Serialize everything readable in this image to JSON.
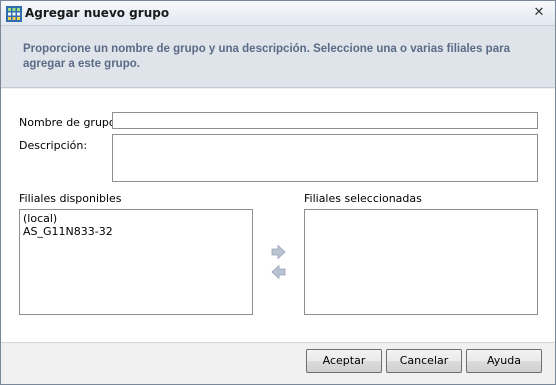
{
  "window": {
    "title": "Agregar nuevo grupo",
    "close_symbol": "✕"
  },
  "banner": {
    "text": "Proporcione un nombre de grupo y una descripción. Seleccione una o varias filiales para agregar a este grupo."
  },
  "form": {
    "group_name_label": "Nombre de grupo:",
    "group_name_value": "",
    "description_label": "Descripción:",
    "description_value": ""
  },
  "available": {
    "label": "Filiales disponibles",
    "items": [
      "(local)",
      "AS_G11N833-32"
    ]
  },
  "selected": {
    "label": "Filiales seleccionadas",
    "items": []
  },
  "buttons": {
    "accept": "Aceptar",
    "cancel": "Cancelar",
    "help": "Ayuda"
  },
  "icons": {
    "app": "group-app-icon",
    "move_right": "arrow-right-icon",
    "move_left": "arrow-left-icon"
  },
  "colors": {
    "banner_bg": "#dfe3ea",
    "banner_text": "#5b6b86",
    "arrow_fill": "#b9c3d2"
  }
}
